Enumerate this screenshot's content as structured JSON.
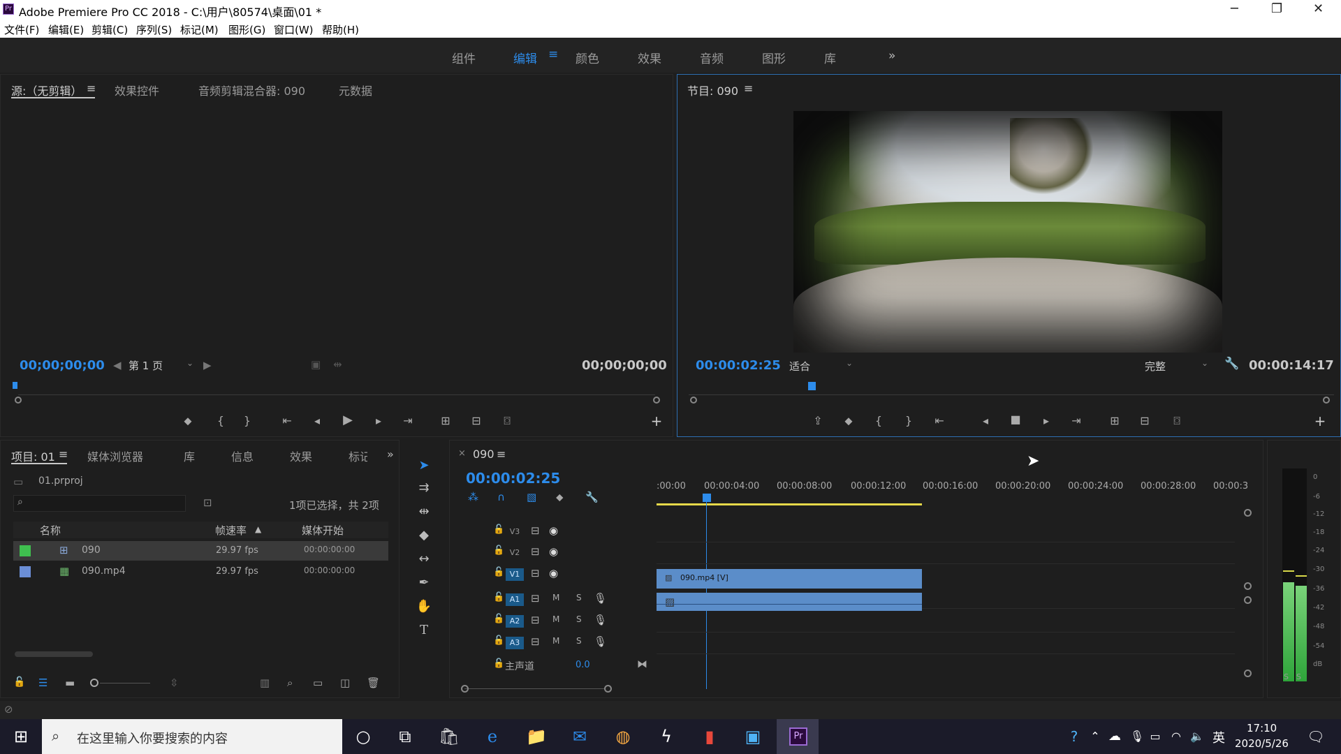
{
  "app": {
    "title": "Adobe Premiere Pro CC 2018 - C:\\用户\\80574\\桌面\\01 *"
  },
  "menu": [
    "文件(F)",
    "编辑(E)",
    "剪辑(C)",
    "序列(S)",
    "标记(M)",
    "图形(G)",
    "窗口(W)",
    "帮助(H)"
  ],
  "workspaces": [
    "组件",
    "编辑",
    "颜色",
    "效果",
    "音频",
    "图形",
    "库"
  ],
  "active_workspace": "编辑",
  "source": {
    "tabs": [
      "源:（无剪辑）",
      "效果控件",
      "音频剪辑混合器: 090",
      "元数据"
    ],
    "timecode_in": "00;00;00;00",
    "page": "第 1 页",
    "timecode_out": "00;00;00;00"
  },
  "program": {
    "tab": "节目: 090",
    "timecode": "00:00:02:25",
    "fit": "适合",
    "quality": "完整",
    "duration": "00:00:14:17"
  },
  "project": {
    "tabs": [
      "项目: 01",
      "媒体浏览器",
      "库",
      "信息",
      "效果",
      "标记"
    ],
    "file": "01.prproj",
    "selection_info": "1项已选择，共 2项",
    "columns": [
      "名称",
      "帧速率",
      "媒体开始"
    ],
    "rows": [
      {
        "name": "090",
        "fps": "29.97 fps",
        "start": "00:00:00:00",
        "color": "#3fbf4f"
      },
      {
        "name": "090.mp4",
        "fps": "29.97 fps",
        "start": "00:00:00:00",
        "color": "#6b8ed6"
      }
    ]
  },
  "timeline": {
    "tab": "090",
    "timecode": "00:00:02:25",
    "ruler": [
      ":00:00",
      "00:00:04:00",
      "00:00:08:00",
      "00:00:12:00",
      "00:00:16:00",
      "00:00:20:00",
      "00:00:24:00",
      "00:00:28:00",
      "00:00:3"
    ],
    "video_tracks": [
      "V3",
      "V2",
      "V1"
    ],
    "audio_tracks": [
      "A1",
      "A2",
      "A3"
    ],
    "master_label": "主声道",
    "master_value": "0.0",
    "clip_v": "090.mp4 [V]"
  },
  "meter": {
    "labels": [
      "0",
      "-6",
      "-12",
      "-18",
      "-24",
      "-30",
      "-36",
      "-42",
      "-48",
      "-54",
      "dB"
    ],
    "solo": [
      "S",
      "S"
    ]
  },
  "taskbar": {
    "search_placeholder": "在这里输入你要搜索的内容",
    "ime": "英",
    "time": "17:10",
    "date": "2020/5/26"
  }
}
